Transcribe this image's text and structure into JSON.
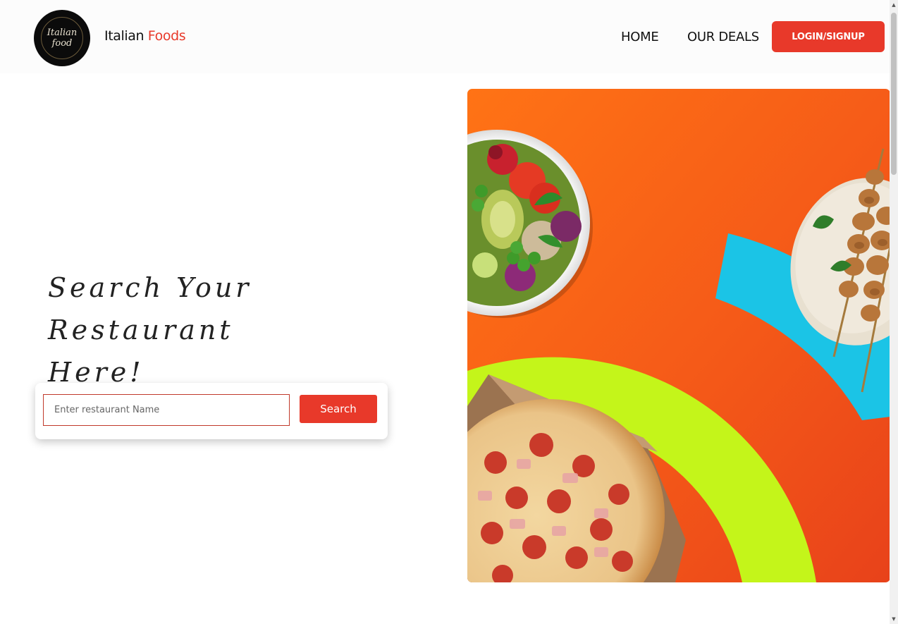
{
  "header": {
    "logo_text": "Italian food",
    "brand_name": "Italian",
    "brand_accent": "Foods",
    "nav": [
      {
        "label": "HOME"
      },
      {
        "label": "OUR DEALS"
      }
    ],
    "login_label": "LOGIN/SIGNUP"
  },
  "hero": {
    "headline_line1": "Search Your Restaurant",
    "headline_line2": "Here!",
    "image_alt": "Food collage: salad bowl, chicken skewers, pepperoni pizza"
  },
  "search": {
    "placeholder": "Enter restaurant Name",
    "value": "",
    "button_label": "Search"
  },
  "colors": {
    "accent": "#e8392a",
    "hero_orange": "#f2561c",
    "hero_cyan": "#1bc4e6",
    "hero_lime": "#c4f51a"
  },
  "scrollbar": {
    "up_icon": "scroll-up-arrow-icon",
    "down_icon": "scroll-down-arrow-icon"
  }
}
